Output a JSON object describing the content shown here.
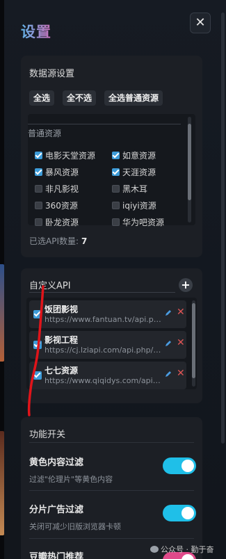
{
  "header": {
    "title": "设置",
    "close_label": "✕"
  },
  "source_settings": {
    "title": "数据源设置",
    "buttons": [
      "全选",
      "全不选",
      "全选普通资源"
    ],
    "group_label": "普通资源",
    "sources": [
      {
        "label": "电影天堂资源",
        "checked": true
      },
      {
        "label": "如意资源",
        "checked": true
      },
      {
        "label": "暴风资源",
        "checked": true
      },
      {
        "label": "天涯资源",
        "checked": true
      },
      {
        "label": "非凡影视",
        "checked": false
      },
      {
        "label": "黑木耳",
        "checked": false
      },
      {
        "label": "360资源",
        "checked": false
      },
      {
        "label": "iqiyi资源",
        "checked": false
      },
      {
        "label": "卧龙资源",
        "checked": false
      },
      {
        "label": "华为吧资源",
        "checked": false
      }
    ],
    "count_label": "已选API数量:",
    "count_value": "7"
  },
  "custom_api": {
    "title": "自定义API",
    "add_label": "+",
    "items": [
      {
        "name": "饭团影视",
        "url": "https://www.fantuan.tv/api.php/provide/vod",
        "checked": true
      },
      {
        "name": "影视工程",
        "url": "https://cj.lziapi.com/api.php/provide/vod",
        "checked": true
      },
      {
        "name": "七七资源",
        "url": "https://www.qiqidys.com/api.php/provide/vod",
        "checked": true
      }
    ]
  },
  "features": {
    "title": "功能开关",
    "items": [
      {
        "name": "黄色内容过滤",
        "desc": "过滤\"伦理片\"等黄色内容",
        "on": true
      },
      {
        "name": "分片广告过滤",
        "desc": "关闭可减少旧版浏览器卡顿",
        "on": true
      },
      {
        "name": "豆瓣热门推荐",
        "desc": "",
        "on": true
      }
    ]
  },
  "watermark": {
    "text": "公众号 · 勤于奋"
  },
  "colors": {
    "accent": "#3d9bd8",
    "toggle_on": "#1fbfe8",
    "toggle_pink": "#e04a8a",
    "delete": "#e05555"
  }
}
